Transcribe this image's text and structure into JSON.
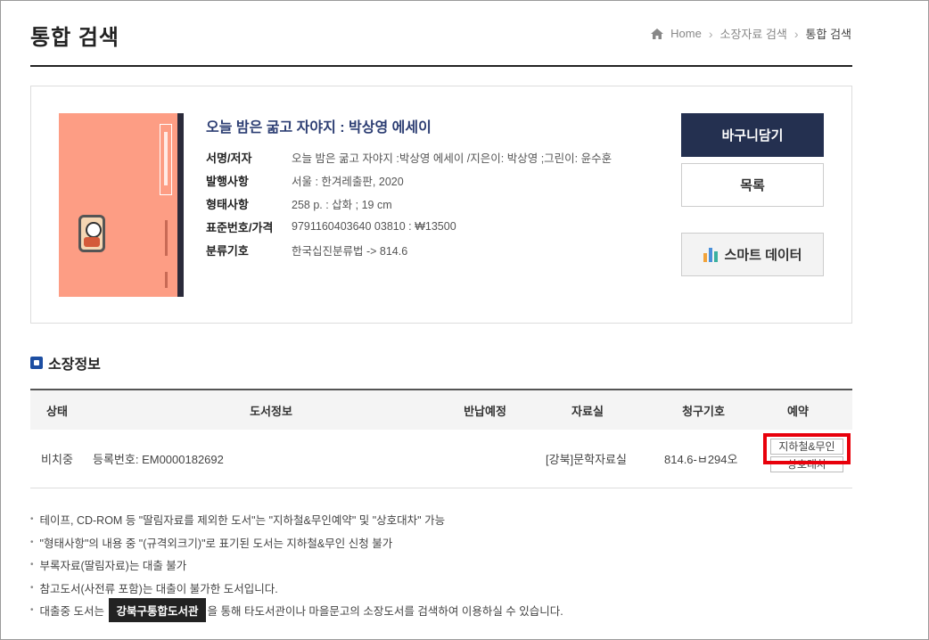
{
  "header": {
    "title": "통합 검색",
    "breadcrumb": [
      "Home",
      "소장자료 검색",
      "통합 검색"
    ]
  },
  "book": {
    "title": "오늘 밤은 굶고 자야지 : 박상영 에세이",
    "meta": [
      {
        "label": "서명/저자",
        "value": "오늘 밤은 굶고 자야지 :박상영 에세이 /지은이: 박상영 ;그린이: 윤수훈"
      },
      {
        "label": "발행사항",
        "value": "서울 : 한겨레출판, 2020"
      },
      {
        "label": "형태사항",
        "value": "258 p. : 삽화 ; 19 cm"
      },
      {
        "label": "표준번호/가격",
        "value": "9791160403640 03810 : ₩13500"
      },
      {
        "label": "분류기호",
        "value": "한국십진분류법 -> 814.6"
      }
    ]
  },
  "actions": {
    "basket": "바구니담기",
    "list": "목록",
    "smart": "스마트 데이터",
    "smart_icon_colors": [
      "#f2a33a",
      "#4a90d9",
      "#3ab0a0"
    ]
  },
  "holdings": {
    "section_title": "소장정보",
    "columns": [
      "상태",
      "도서정보",
      "반납예정",
      "자료실",
      "청구기호",
      "예약"
    ],
    "rows": [
      {
        "status": "비치중",
        "reg_no": "등록번호: EM0000182692",
        "due": "",
        "location": "[강북]문학자료실",
        "call_no": "814.6-ㅂ294오",
        "reserve_buttons": [
          "지하철&무인",
          "상호대차"
        ]
      }
    ]
  },
  "notes": {
    "items": [
      "테이프, CD-ROM 등 \"딸림자료를 제외한 도서\"는 \"지하철&무인예약\" 및 \"상호대차\" 가능",
      "\"형태사항\"의 내용 중 \"(규격외크기)\"로 표기된 도서는 지하철&무인 신청 불가",
      "부록자료(딸림자료)는 대출 불가",
      "참고도서(사전류 포함)는 대출이 불가한 도서입니다."
    ],
    "last_prefix": "대출중 도서는",
    "last_tag": "강북구통합도서관",
    "last_suffix": "을 통해 타도서관이나 마을문고의 소장도서를 검색하여 이용하실 수 있습니다."
  }
}
